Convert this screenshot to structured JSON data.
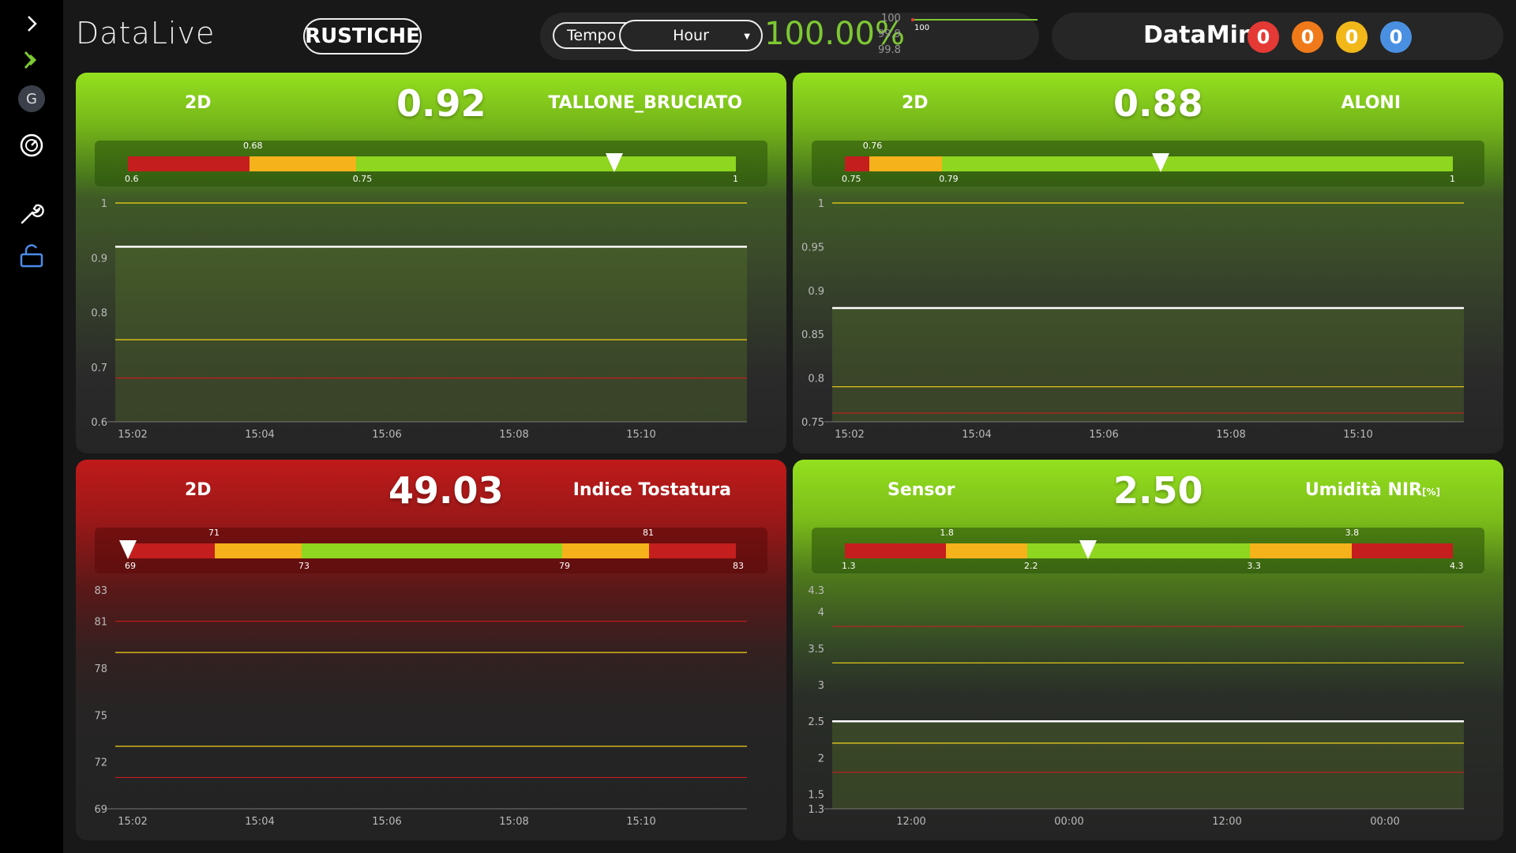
{
  "sidebar": {
    "avatar_initial": "G",
    "icons": [
      "chevron-right-icon",
      "double-chevron-icon",
      "avatar",
      "gauge-icon",
      "wrench-icon",
      "unlock-icon"
    ]
  },
  "header": {
    "brand": "DataLive",
    "group_button": "RUSTICHE",
    "tempo_label": "Tempo",
    "tempo_select": "Hour",
    "percentage": "100.00%",
    "mini_axis": [
      "100",
      "99.9",
      "99.8"
    ],
    "mini_label": "100",
    "datamind_title": "DataMind",
    "badges": [
      {
        "count": "0",
        "color": "#e53935"
      },
      {
        "count": "0",
        "color": "#f07a1a"
      },
      {
        "count": "0",
        "color": "#f2b81a"
      },
      {
        "count": "0",
        "color": "#4a90e2"
      }
    ]
  },
  "panels": [
    {
      "left_label": "2D",
      "value": "0.92",
      "right_label": "TALLONE_BRUCIATO",
      "unit": "",
      "theme": "green",
      "gauge": {
        "min": 0.6,
        "max": 1,
        "ticks_bottom": [
          "0.6",
          "0.75",
          "1"
        ],
        "ticks_top": [
          "0.68"
        ],
        "marker": 0.92,
        "segments": [
          {
            "from": 0.6,
            "to": 0.68,
            "color": "#c41e1e"
          },
          {
            "from": 0.68,
            "to": 0.75,
            "color": "#f5b21a"
          },
          {
            "from": 0.75,
            "to": 1,
            "color": "#8ed61f"
          }
        ]
      },
      "chart_data": {
        "type": "line",
        "y_ticks": [
          "1",
          "0.9",
          "0.8",
          "0.7",
          "0.6"
        ],
        "x_ticks": [
          "15:02",
          "15:04",
          "15:06",
          "15:08",
          "15:10"
        ],
        "ylim": [
          0.6,
          1
        ],
        "series_value": 0.92,
        "limits": [
          {
            "value": 1,
            "color": "#f5d21a"
          },
          {
            "value": 0.75,
            "color": "#f5d21a"
          },
          {
            "value": 0.68,
            "color": "#c41e1e"
          }
        ]
      }
    },
    {
      "left_label": "2D",
      "value": "0.88",
      "right_label": "ALONI",
      "unit": "",
      "theme": "green",
      "gauge": {
        "min": 0.75,
        "max": 1,
        "ticks_bottom": [
          "0.75",
          "0.79",
          "1"
        ],
        "ticks_top": [
          "0.76"
        ],
        "marker": 0.88,
        "segments": [
          {
            "from": 0.75,
            "to": 0.76,
            "color": "#c41e1e"
          },
          {
            "from": 0.76,
            "to": 0.79,
            "color": "#f5b21a"
          },
          {
            "from": 0.79,
            "to": 1,
            "color": "#8ed61f"
          }
        ]
      },
      "chart_data": {
        "type": "line",
        "y_ticks": [
          "1",
          "0.95",
          "0.9",
          "0.85",
          "0.8",
          "0.75"
        ],
        "x_ticks": [
          "15:02",
          "15:04",
          "15:06",
          "15:08",
          "15:10"
        ],
        "ylim": [
          0.75,
          1
        ],
        "series_value": 0.88,
        "limits": [
          {
            "value": 1,
            "color": "#f5d21a"
          },
          {
            "value": 0.79,
            "color": "#f5d21a"
          },
          {
            "value": 0.76,
            "color": "#c41e1e"
          }
        ]
      }
    },
    {
      "left_label": "2D",
      "value": "49.03",
      "right_label": "Indice Tostatura",
      "unit": "",
      "theme": "red",
      "gauge": {
        "min": 69,
        "max": 83,
        "ticks_bottom": [
          "69",
          "73",
          "79",
          "83"
        ],
        "ticks_top": [
          "71",
          "81"
        ],
        "marker": 69,
        "segments": [
          {
            "from": 69,
            "to": 71,
            "color": "#c41e1e"
          },
          {
            "from": 71,
            "to": 73,
            "color": "#f5b21a"
          },
          {
            "from": 73,
            "to": 79,
            "color": "#8ed61f"
          },
          {
            "from": 79,
            "to": 81,
            "color": "#f5b21a"
          },
          {
            "from": 81,
            "to": 83,
            "color": "#c41e1e"
          }
        ]
      },
      "chart_data": {
        "type": "line",
        "y_ticks": [
          "83",
          "81",
          "78",
          "75",
          "72",
          "69"
        ],
        "x_ticks": [
          "15:02",
          "15:04",
          "15:06",
          "15:08",
          "15:10"
        ],
        "ylim": [
          69,
          83
        ],
        "series_value": null,
        "limits": [
          {
            "value": 81,
            "color": "#c41e1e"
          },
          {
            "value": 79,
            "color": "#f5d21a"
          },
          {
            "value": 73,
            "color": "#f5d21a"
          },
          {
            "value": 71,
            "color": "#c41e1e"
          }
        ]
      }
    },
    {
      "left_label": "Sensor",
      "value": "2.50",
      "right_label": "Umidità NIR",
      "unit": "[%]",
      "theme": "green2",
      "gauge": {
        "min": 1.3,
        "max": 4.3,
        "ticks_bottom": [
          "1.3",
          "2.2",
          "3.3",
          "4.3"
        ],
        "ticks_top": [
          "1.8",
          "3.8"
        ],
        "marker": 2.5,
        "segments": [
          {
            "from": 1.3,
            "to": 1.8,
            "color": "#c41e1e"
          },
          {
            "from": 1.8,
            "to": 2.2,
            "color": "#f5b21a"
          },
          {
            "from": 2.2,
            "to": 3.3,
            "color": "#8ed61f"
          },
          {
            "from": 3.3,
            "to": 3.8,
            "color": "#f5b21a"
          },
          {
            "from": 3.8,
            "to": 4.3,
            "color": "#c41e1e"
          }
        ]
      },
      "chart_data": {
        "type": "line",
        "y_ticks": [
          "4.3",
          "4",
          "3.5",
          "3",
          "2.5",
          "2",
          "1.5",
          "1.3"
        ],
        "x_ticks": [
          "12:00",
          "00:00",
          "12:00",
          "00:00"
        ],
        "ylim": [
          1.3,
          4.3
        ],
        "series_value": 2.5,
        "limits": [
          {
            "value": 3.8,
            "color": "#c41e1e"
          },
          {
            "value": 3.3,
            "color": "#f5d21a"
          },
          {
            "value": 2.2,
            "color": "#f5d21a"
          },
          {
            "value": 1.8,
            "color": "#c41e1e"
          }
        ]
      }
    }
  ]
}
